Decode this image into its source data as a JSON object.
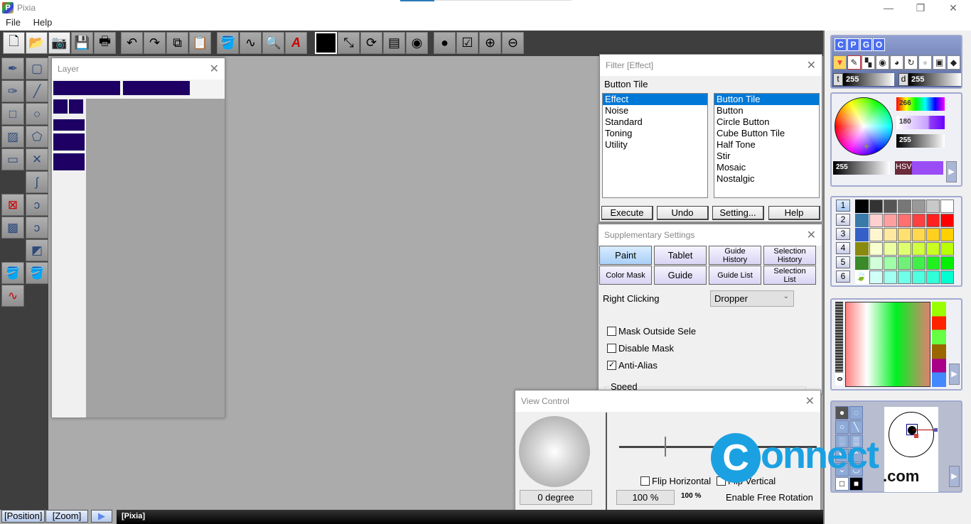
{
  "window": {
    "title": "Pixia",
    "app_icon": "pixia-app-icon",
    "controls": {
      "minimize": "—",
      "restore": "❐",
      "close": "✕"
    }
  },
  "menu": [
    "File",
    "Help"
  ],
  "toolbar": {
    "file_group": [
      {
        "name": "new-file-icon",
        "glyph": "🗋"
      },
      {
        "name": "open-folder-icon",
        "glyph": "📂"
      },
      {
        "name": "camera-icon",
        "glyph": "📷"
      },
      {
        "name": "save-icon",
        "glyph": "💾"
      },
      {
        "name": "print-icon",
        "glyph": "🖶"
      }
    ],
    "edit_group": [
      {
        "name": "undo-icon",
        "glyph": "↶"
      },
      {
        "name": "redo-icon",
        "glyph": "↷"
      },
      {
        "name": "copy-icon",
        "glyph": "⧉"
      },
      {
        "name": "paste-icon",
        "glyph": "📋"
      }
    ],
    "paint_group": [
      {
        "name": "fill-bucket-icon",
        "glyph": "🪣"
      },
      {
        "name": "fill-line-icon",
        "glyph": "∿"
      },
      {
        "name": "magnifier-icon",
        "glyph": "🔍"
      },
      {
        "name": "text-tool-icon",
        "glyph": "A"
      }
    ],
    "view_group": [
      {
        "name": "color-swatch-icon",
        "glyph": ""
      },
      {
        "name": "transform-icon",
        "glyph": "⤡"
      },
      {
        "name": "rotate-layer-icon",
        "glyph": "⟳"
      },
      {
        "name": "layer-merge-icon",
        "glyph": "▤"
      },
      {
        "name": "layer-option-icon",
        "glyph": "◉"
      }
    ],
    "misc_group": [
      {
        "name": "sphere-icon",
        "glyph": "●"
      },
      {
        "name": "checklist-icon",
        "glyph": "☑"
      },
      {
        "name": "zoom-in-icon",
        "glyph": "⊕"
      },
      {
        "name": "zoom-out-icon",
        "glyph": "⊖"
      }
    ]
  },
  "left_tools": [
    {
      "name": "pen-tool-icon",
      "glyph": "✒"
    },
    {
      "name": "rectangle-select-icon",
      "glyph": "▢"
    },
    {
      "name": "airbrush-pen-icon",
      "glyph": "✑"
    },
    {
      "name": "line-tool-icon",
      "glyph": "╱"
    },
    {
      "name": "rectangle-tool-icon",
      "glyph": "□"
    },
    {
      "name": "circle-tool-icon",
      "glyph": "○"
    },
    {
      "name": "gradient-tool-icon",
      "glyph": "▨"
    },
    {
      "name": "polygon-tool-icon",
      "glyph": "⬠"
    },
    {
      "name": "square-outline-icon",
      "glyph": "▭"
    },
    {
      "name": "cross-line-icon",
      "glyph": "✕"
    },
    {
      "name": "curve-tool-icon",
      "glyph": "∫"
    },
    {
      "name": "delete-selection-icon",
      "glyph": "⊠"
    },
    {
      "name": "bezier-curve-icon",
      "glyph": "ↄ"
    },
    {
      "name": "transparency-icon",
      "glyph": "▩"
    },
    {
      "name": "bezier-pen-icon",
      "glyph": "ↄ"
    },
    {
      "name": "polygon-fill-icon",
      "glyph": "◩"
    },
    {
      "name": "red-bucket-icon",
      "glyph": "🪣"
    },
    {
      "name": "blue-bucket-icon",
      "glyph": "🪣"
    },
    {
      "name": "red-fill-line-icon",
      "glyph": "∿"
    }
  ],
  "layer_panel": {
    "title": "Layer",
    "close": "✕"
  },
  "filter_panel": {
    "title": "Filter [Effect]",
    "selected_label": "Button Tile",
    "categories": [
      "Effect",
      "Noise",
      "Standard",
      "Toning",
      "Utility"
    ],
    "selected_category": "Effect",
    "filters": [
      "Button Tile",
      "Button",
      "Circle Button",
      "Cube Button Tile",
      "Half Tone",
      "Stir",
      "Mosaic",
      "Nostalgic"
    ],
    "selected_filter": "Button Tile",
    "buttons": {
      "execute": "Execute",
      "undo": "Undo",
      "setting": "Setting...",
      "help": "Help"
    },
    "close": "✕"
  },
  "supplementary_panel": {
    "title": "Supplementary Settings",
    "tabs": [
      {
        "label": "Paint",
        "active": true
      },
      {
        "label": "Tablet",
        "active": false
      },
      {
        "label": "Guide History",
        "active": false
      },
      {
        "label": "Selection History",
        "active": false
      },
      {
        "label": "Color Mask",
        "active": false
      },
      {
        "label": "Guide",
        "active": false
      },
      {
        "label": "Guide List",
        "active": false
      },
      {
        "label": "Selection List",
        "active": false
      }
    ],
    "right_clicking_label": "Right Clicking",
    "right_clicking_value": "Dropper",
    "checkboxes": [
      {
        "label": "Mask Outside Sele",
        "checked": false
      },
      {
        "label": "Disable Mask",
        "checked": false
      },
      {
        "label": "Anti-Alias",
        "checked": true
      }
    ],
    "speed_label": "Speed",
    "close": "✕"
  },
  "view_control": {
    "title": "View Control",
    "rotation": "0 degree",
    "zoom_value": "100 %",
    "zoom_small": "100 %",
    "zoom_slider_fraction": 0.23,
    "flip_horizontal": {
      "label": "Flip Horizontal",
      "checked": false
    },
    "flip_vertical": {
      "label": "Flip Vertical",
      "checked": false
    },
    "free_rotation_label": "Enable Free Rotation",
    "close": "✕"
  },
  "right_panel": {
    "mode_tabs": [
      "C",
      "P",
      "G",
      "O"
    ],
    "brush_modes": [
      "dropdown-icon",
      "pencil-icon",
      "checker-icon",
      "blur-dot-icon",
      "smudge-icon",
      "lasso-icon",
      "circle-icon",
      "overlap-icon",
      "eraser-icon"
    ],
    "t_label": "t",
    "t_value": "255",
    "d_label": "d",
    "d_value": "255",
    "hue_value": "266",
    "saturation_value": "180",
    "value_value": "255",
    "alpha_value": "255",
    "color_mode": "HSV",
    "current_color": "#9a4cf5",
    "palette_tabs": [
      "1",
      "2",
      "3",
      "4",
      "5",
      "6"
    ],
    "palette_rows": [
      [
        "#000000",
        "#333333",
        "#555555",
        "#777777",
        "#999999",
        "#c8c8c8",
        "#ffffff"
      ],
      [
        "#ffd0d0",
        "#ffa0a0",
        "#ff7070",
        "#ff4040",
        "#ff2020",
        "#ff0000"
      ],
      [
        "#fff6d0",
        "#ffe9a0",
        "#ffe070",
        "#ffd850",
        "#ffd020",
        "#ffd000"
      ],
      [
        "#f8ffd0",
        "#ecff a0",
        "#e0ff70",
        "#d0ff40",
        "#c8ff20",
        "#b8ff00"
      ],
      [
        "#d0ffd8",
        "#a0ffa8",
        "#70f078",
        "#40f048",
        "#20f020",
        "#00f000"
      ],
      [
        "#d0fff8",
        "#a0fff0",
        "#70ffe8",
        "#50ffe0",
        "#30ffd8",
        "#00ffd0"
      ]
    ],
    "gradient_scale_label": "0",
    "brush_shapes": [
      "solid-brush-icon",
      "dotted-brush-icon",
      "soft-brush-icon",
      "slash-brush-icon",
      "halftone-brush-icon",
      "dense-halftone-icon",
      "star-brush-icon",
      "fan-brush-icon",
      "wave-brush-icon",
      "arc-brush-icon",
      "white-square-icon",
      "black-square-icon"
    ]
  },
  "status": {
    "position_button": "[Position]",
    "zoom_button": "[Zoom]",
    "play_glyph": "▶",
    "document": "[Pixia]"
  },
  "watermark": {
    "text": "Connect",
    "suffix": ".com",
    "color": "#1ba1e2"
  }
}
